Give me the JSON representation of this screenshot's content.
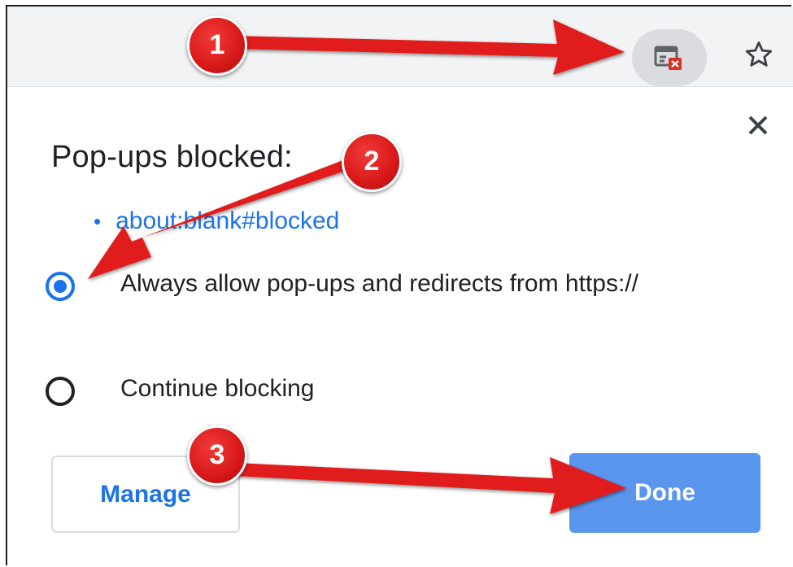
{
  "toolbar": {
    "popup_blocked_icon": "popup-blocked-icon",
    "bookmark_icon": "star-icon"
  },
  "dialog": {
    "title": "Pop-ups blocked:",
    "blocked_items": [
      "about:blank#blocked"
    ],
    "options": [
      {
        "label": "Always allow pop-ups and redirects from https://",
        "selected": true
      },
      {
        "label": "Continue blocking",
        "selected": false
      }
    ],
    "manage_label": "Manage",
    "done_label": "Done",
    "close_icon": "close-icon"
  },
  "annotations": {
    "badges": [
      "1",
      "2",
      "3"
    ],
    "color": "#e01b1b"
  }
}
